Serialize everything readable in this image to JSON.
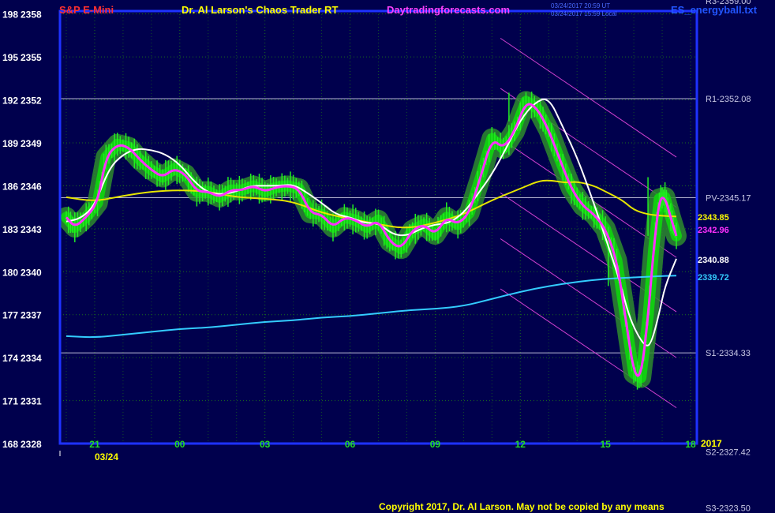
{
  "header": {
    "instrument": "S&P E-Mini",
    "product": "Dr. Al Larson's Chaos Trader RT",
    "website": "Daytradingforecasts.com",
    "timestamp_1": "03/24/2017 20:59 UT",
    "timestamp_2": "03/24/2017 15:59 Local",
    "data_file": "ES_energyball.txt"
  },
  "footer": {
    "copyright": "Copyright 2017, Dr. Al Larson. May not be copied by any means"
  },
  "colors": {
    "background": "#00004d",
    "frame": "#1e32ff",
    "grid": "#1b6b1b",
    "price_band": "#11cc11",
    "magenta": "#ff30ff",
    "white": "#ffffff",
    "yellow": "#e6e600",
    "cyan": "#33ccff",
    "channel": "#d040d0"
  },
  "chart_data": {
    "type": "line",
    "title": "S&P E-Mini",
    "y_ticks": [
      {
        "left": "198",
        "right": "2358",
        "price": 2358
      },
      {
        "left": "195",
        "right": "2355",
        "price": 2355
      },
      {
        "left": "192",
        "right": "2352",
        "price": 2352
      },
      {
        "left": "189",
        "right": "2349",
        "price": 2349
      },
      {
        "left": "186",
        "right": "2346",
        "price": 2346
      },
      {
        "left": "183",
        "right": "2343",
        "price": 2343
      },
      {
        "left": "180",
        "right": "2340",
        "price": 2340
      },
      {
        "left": "177",
        "right": "2337",
        "price": 2337
      },
      {
        "left": "174",
        "right": "2334",
        "price": 2334
      },
      {
        "left": "171",
        "right": "2331",
        "price": 2331
      },
      {
        "left": "168",
        "right": "2328",
        "price": 2328
      }
    ],
    "ylim": [
      2328,
      2358.2
    ],
    "xlim": [
      19.0,
      37.0
    ],
    "x_ticks": [
      {
        "label": "21",
        "x": 21
      },
      {
        "label": "00",
        "x": 24
      },
      {
        "label": "03",
        "x": 27
      },
      {
        "label": "06",
        "x": 30
      },
      {
        "label": "09",
        "x": 33
      },
      {
        "label": "12",
        "x": 36
      },
      {
        "label": "15",
        "x": 39
      },
      {
        "label": "18",
        "x": 42
      }
    ],
    "date_label": "03/24",
    "year_label": "2017",
    "levels": [
      {
        "label": "R3-2359.00",
        "price": 2359.0
      },
      {
        "label": "R1-2352.08",
        "price": 2352.08
      },
      {
        "label": "PV-2345.17",
        "price": 2345.17
      },
      {
        "label": "S1-2334.33",
        "price": 2334.33
      },
      {
        "label": "S2-2327.42",
        "price": 2327.42
      },
      {
        "label": "S3-2323.50",
        "price": 2323.5
      }
    ],
    "last_values": [
      {
        "label": "2343.85",
        "color": "#ffff00",
        "price": 2343.85
      },
      {
        "label": "2342.96",
        "color": "#ff30ff",
        "price": 2342.96
      },
      {
        "label": "2340.88",
        "color": "#ffffff",
        "price": 2340.88
      },
      {
        "label": "2339.72",
        "color": "#33ccff",
        "price": 2339.72
      }
    ],
    "series": [
      {
        "color": "#ff30ff",
        "values": [
          [
            19.0,
            2343.8
          ],
          [
            19.3,
            2343.1
          ],
          [
            19.7,
            2343.8
          ],
          [
            20.1,
            2344.8
          ],
          [
            20.4,
            2348.0
          ],
          [
            20.8,
            2348.9
          ],
          [
            21.2,
            2348.7
          ],
          [
            21.6,
            2347.8
          ],
          [
            22.0,
            2347.1
          ],
          [
            22.4,
            2346.6
          ],
          [
            22.8,
            2347.2
          ],
          [
            23.2,
            2346.8
          ],
          [
            23.6,
            2345.6
          ],
          [
            24.0,
            2345.6
          ],
          [
            24.4,
            2345.2
          ],
          [
            24.8,
            2345.7
          ],
          [
            25.2,
            2345.7
          ],
          [
            25.6,
            2346.0
          ],
          [
            26.0,
            2345.6
          ],
          [
            26.4,
            2345.9
          ],
          [
            26.8,
            2346.0
          ],
          [
            27.2,
            2345.8
          ],
          [
            27.6,
            2344.1
          ],
          [
            28.0,
            2344.0
          ],
          [
            28.4,
            2343.1
          ],
          [
            28.8,
            2343.8
          ],
          [
            29.2,
            2343.6
          ],
          [
            29.6,
            2343.1
          ],
          [
            30.0,
            2343.6
          ],
          [
            30.4,
            2342.1
          ],
          [
            30.8,
            2341.6
          ],
          [
            31.2,
            2342.9
          ],
          [
            31.6,
            2343.3
          ],
          [
            32.0,
            2342.6
          ],
          [
            32.4,
            2343.8
          ],
          [
            32.8,
            2343.3
          ],
          [
            33.2,
            2344.1
          ],
          [
            33.6,
            2346.6
          ],
          [
            34.0,
            2349.3
          ],
          [
            34.4,
            2348.6
          ],
          [
            34.8,
            2349.8
          ],
          [
            35.2,
            2351.9
          ],
          [
            35.6,
            2351.4
          ],
          [
            36.0,
            2349.9
          ],
          [
            36.4,
            2347.8
          ],
          [
            36.8,
            2345.8
          ],
          [
            37.2,
            2344.6
          ],
          [
            37.6,
            2344.0
          ],
          [
            38.0,
            2343.0
          ],
          [
            38.4,
            2340.8
          ],
          [
            38.7,
            2336.9
          ],
          [
            39.0,
            2332.9
          ],
          [
            39.25,
            2332.6
          ],
          [
            39.5,
            2336.8
          ],
          [
            39.7,
            2341.6
          ],
          [
            39.9,
            2345.1
          ],
          [
            40.1,
            2345.2
          ],
          [
            40.3,
            2343.8
          ],
          [
            40.5,
            2342.5
          ]
        ]
      },
      {
        "color": "#ffffff",
        "values": [
          [
            19.0,
            2343.5
          ],
          [
            19.5,
            2343.7
          ],
          [
            20.0,
            2344.6
          ],
          [
            20.5,
            2347.2
          ],
          [
            21.0,
            2348.2
          ],
          [
            21.5,
            2348.6
          ],
          [
            22.0,
            2348.5
          ],
          [
            22.5,
            2348.2
          ],
          [
            23.0,
            2347.5
          ],
          [
            23.5,
            2346.3
          ],
          [
            24.0,
            2345.5
          ],
          [
            24.5,
            2345.4
          ],
          [
            25.0,
            2345.6
          ],
          [
            25.5,
            2346.0
          ],
          [
            26.0,
            2346.0
          ],
          [
            26.5,
            2346.0
          ],
          [
            27.0,
            2346.1
          ],
          [
            27.5,
            2345.5
          ],
          [
            28.0,
            2344.8
          ],
          [
            28.5,
            2344.0
          ],
          [
            29.0,
            2343.8
          ],
          [
            29.5,
            2343.4
          ],
          [
            30.0,
            2343.4
          ],
          [
            30.5,
            2342.6
          ],
          [
            31.0,
            2342.5
          ],
          [
            31.5,
            2343.0
          ],
          [
            32.0,
            2343.3
          ],
          [
            32.5,
            2343.4
          ],
          [
            33.0,
            2344.1
          ],
          [
            33.5,
            2345.4
          ],
          [
            34.0,
            2346.8
          ],
          [
            34.5,
            2348.6
          ],
          [
            35.0,
            2350.6
          ],
          [
            35.5,
            2351.8
          ],
          [
            36.0,
            2352.2
          ],
          [
            36.5,
            2350.1
          ],
          [
            37.0,
            2348.0
          ],
          [
            37.5,
            2345.3
          ],
          [
            38.0,
            2342.4
          ],
          [
            38.5,
            2339.4
          ],
          [
            38.8,
            2337.1
          ],
          [
            39.1,
            2335.7
          ],
          [
            39.4,
            2334.8
          ],
          [
            39.6,
            2334.9
          ],
          [
            39.9,
            2337.1
          ],
          [
            40.1,
            2339.0
          ],
          [
            40.5,
            2340.9
          ]
        ]
      },
      {
        "color": "#e6e600",
        "values": [
          [
            19.0,
            2345.2
          ],
          [
            20.0,
            2344.9
          ],
          [
            21.0,
            2345.3
          ],
          [
            22.0,
            2345.6
          ],
          [
            23.0,
            2345.7
          ],
          [
            24.0,
            2345.6
          ],
          [
            25.0,
            2345.2
          ],
          [
            26.0,
            2345.1
          ],
          [
            27.0,
            2344.9
          ],
          [
            28.0,
            2344.1
          ],
          [
            29.0,
            2343.7
          ],
          [
            30.0,
            2343.3
          ],
          [
            31.0,
            2343.0
          ],
          [
            32.0,
            2343.4
          ],
          [
            33.0,
            2344.0
          ],
          [
            34.0,
            2345.0
          ],
          [
            35.0,
            2345.8
          ],
          [
            35.6,
            2346.3
          ],
          [
            36.0,
            2346.4
          ],
          [
            36.6,
            2346.2
          ],
          [
            37.0,
            2346.3
          ],
          [
            37.6,
            2346.0
          ],
          [
            38.0,
            2345.6
          ],
          [
            38.6,
            2345.0
          ],
          [
            39.0,
            2344.3
          ],
          [
            39.5,
            2344.0
          ],
          [
            40.0,
            2343.9
          ],
          [
            40.5,
            2343.85
          ]
        ]
      },
      {
        "color": "#33ccff",
        "values": [
          [
            19.0,
            2335.5
          ],
          [
            20.0,
            2335.4
          ],
          [
            21.0,
            2335.6
          ],
          [
            22.0,
            2335.8
          ],
          [
            23.0,
            2336.0
          ],
          [
            24.0,
            2336.1
          ],
          [
            25.0,
            2336.3
          ],
          [
            26.0,
            2336.5
          ],
          [
            27.0,
            2336.6
          ],
          [
            28.0,
            2336.8
          ],
          [
            29.0,
            2336.9
          ],
          [
            30.0,
            2337.1
          ],
          [
            31.0,
            2337.3
          ],
          [
            32.0,
            2337.4
          ],
          [
            33.0,
            2337.6
          ],
          [
            34.0,
            2338.1
          ],
          [
            35.0,
            2338.6
          ],
          [
            36.0,
            2339.0
          ],
          [
            37.0,
            2339.3
          ],
          [
            38.0,
            2339.5
          ],
          [
            39.0,
            2339.6
          ],
          [
            40.0,
            2339.7
          ],
          [
            40.5,
            2339.72
          ]
        ]
      }
    ],
    "channel_lines": [
      {
        "x1": 34.3,
        "y1": 2356.3,
        "x2": 40.5,
        "y2": 2348.0
      },
      {
        "x1": 34.3,
        "y1": 2352.8,
        "x2": 40.5,
        "y2": 2344.5
      },
      {
        "x1": 34.3,
        "y1": 2349.3,
        "x2": 40.5,
        "y2": 2341.0
      },
      {
        "x1": 34.3,
        "y1": 2345.5,
        "x2": 40.5,
        "y2": 2337.2
      },
      {
        "x1": 34.3,
        "y1": 2342.3,
        "x2": 40.5,
        "y2": 2334.0
      },
      {
        "x1": 34.3,
        "y1": 2338.8,
        "x2": 40.5,
        "y2": 2330.5
      }
    ]
  }
}
